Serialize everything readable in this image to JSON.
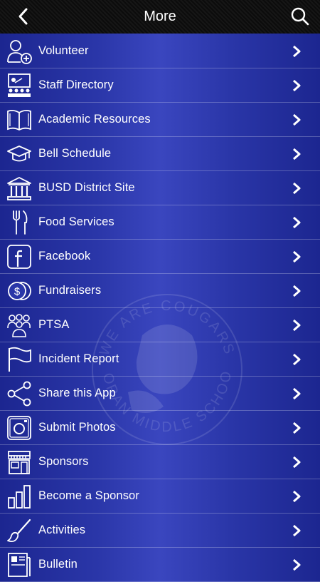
{
  "header": {
    "title": "More",
    "back_icon": "chevron-left-icon",
    "search_icon": "search-icon"
  },
  "watermark": {
    "text_top": "WE ARE COUGARS",
    "text_bottom": "MORAN MIDDLE SCHOOL"
  },
  "menu": [
    {
      "label": "Volunteer",
      "icon": "add-user-icon"
    },
    {
      "label": "Staff Directory",
      "icon": "classroom-icon"
    },
    {
      "label": "Academic Resources",
      "icon": "book-icon"
    },
    {
      "label": "Bell Schedule",
      "icon": "graduation-cap-icon"
    },
    {
      "label": "BUSD District Site",
      "icon": "bank-building-icon"
    },
    {
      "label": "Food Services",
      "icon": "fork-knife-icon"
    },
    {
      "label": "Facebook",
      "icon": "facebook-icon"
    },
    {
      "label": "Fundraisers",
      "icon": "coins-icon"
    },
    {
      "label": "PTSA",
      "icon": "group-icon"
    },
    {
      "label": "Incident Report",
      "icon": "flag-icon"
    },
    {
      "label": "Share this App",
      "icon": "share-icon"
    },
    {
      "label": "Submit Photos",
      "icon": "instagram-icon"
    },
    {
      "label": "Sponsors",
      "icon": "storefront-icon"
    },
    {
      "label": "Become a Sponsor",
      "icon": "bar-chart-icon"
    },
    {
      "label": "Activities",
      "icon": "paintbrush-icon"
    },
    {
      "label": "Bulletin",
      "icon": "newspaper-icon"
    }
  ],
  "colors": {
    "background_edge": "#1c2690",
    "background_center": "#3a46bf",
    "header_bg": "#0f0f0f",
    "text": "#ffffff"
  }
}
